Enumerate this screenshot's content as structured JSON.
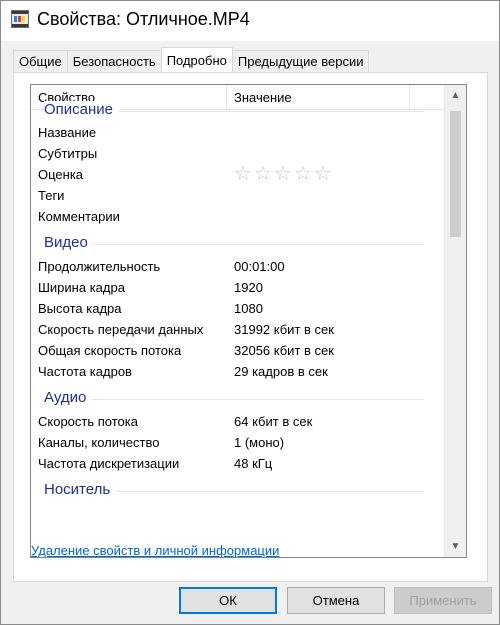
{
  "window": {
    "title": "Свойства: Отличное.MP4"
  },
  "tabs": [
    {
      "label": "Общие"
    },
    {
      "label": "Безопасность"
    },
    {
      "label": "Подробно"
    },
    {
      "label": "Предыдущие версии"
    }
  ],
  "active_tab": "Подробно",
  "listview": {
    "col_property": "Свойство",
    "col_value": "Значение",
    "groups": {
      "description": {
        "title": "Описание",
        "rows": [
          {
            "name": "Название",
            "value": ""
          },
          {
            "name": "Субтитры",
            "value": ""
          },
          {
            "name": "Оценка",
            "value": ""
          },
          {
            "name": "Теги",
            "value": ""
          },
          {
            "name": "Комментарии",
            "value": ""
          }
        ],
        "rating_stars": 0,
        "rating_max": 5
      },
      "video": {
        "title": "Видео",
        "rows": [
          {
            "name": "Продолжительность",
            "value": "00:01:00"
          },
          {
            "name": "Ширина кадра",
            "value": "1920"
          },
          {
            "name": "Высота кадра",
            "value": "1080"
          },
          {
            "name": "Скорость передачи данных",
            "value": "31992 кбит в сек"
          },
          {
            "name": "Общая скорость потока",
            "value": "32056 кбит в сек"
          },
          {
            "name": "Частота кадров",
            "value": "29 кадров в сек"
          }
        ]
      },
      "audio": {
        "title": "Аудио",
        "rows": [
          {
            "name": "Скорость потока",
            "value": "64 кбит в сек"
          },
          {
            "name": "Каналы, количество",
            "value": "1 (моно)"
          },
          {
            "name": "Частота дискретизации",
            "value": "48 кГц"
          }
        ]
      },
      "media": {
        "title": "Носитель"
      }
    }
  },
  "link": {
    "remove_properties": "Удаление свойств и личной информации"
  },
  "buttons": {
    "ok": "ОК",
    "cancel": "Отмена",
    "apply": "Применить"
  },
  "icons": {
    "scroll_up": "chevron-up-icon",
    "scroll_down": "chevron-down-icon",
    "star": "star-outline-icon"
  },
  "colors": {
    "group_title": "#1e3287",
    "link": "#0066cc",
    "default_button_border": "#0078d7"
  }
}
